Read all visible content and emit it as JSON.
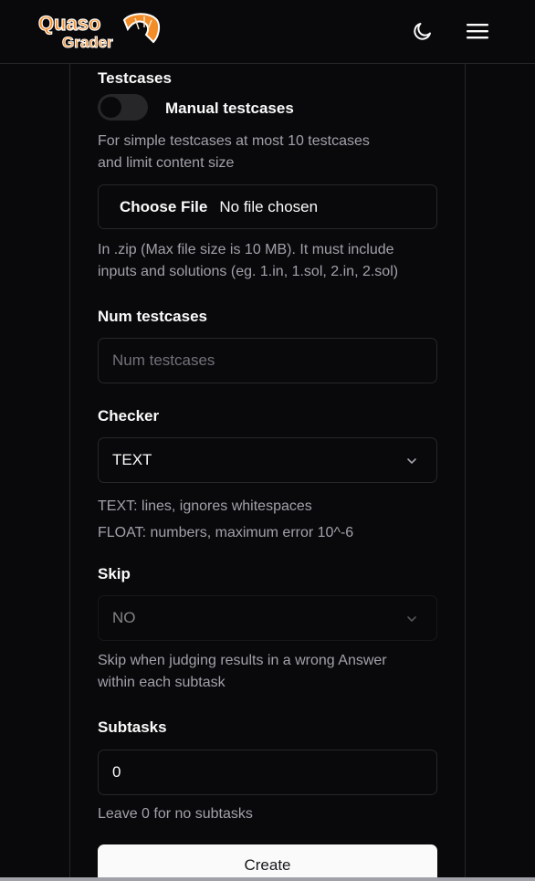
{
  "brand": {
    "line1": "Quaso",
    "line2": "Grader",
    "accent": "#f28c28"
  },
  "nav": {
    "theme_icon": "moon-icon",
    "menu_icon": "hamburger-menu-icon"
  },
  "testcases": {
    "label": "Testcases",
    "toggle_label": "Manual testcases",
    "toggle_on": false,
    "help": [
      "For simple testcases at most 10 testcases",
      "and limit content size"
    ],
    "file_button": "Choose File",
    "file_status": "No file chosen",
    "file_help": [
      "In .zip (Max file size is 10 MB). It must include",
      "inputs and solutions (eg. 1.in, 1.sol, 2.in, 2.sol)"
    ]
  },
  "num_testcases": {
    "label": "Num testcases",
    "placeholder": "Num testcases"
  },
  "checker": {
    "label": "Checker",
    "value": "TEXT",
    "help": [
      "TEXT: lines, ignores whitespaces",
      "FLOAT: numbers, maximum error 10^-6"
    ]
  },
  "skip": {
    "label": "Skip",
    "value": "NO",
    "help": [
      "Skip when judging results in a wrong Answer",
      "within each subtask"
    ]
  },
  "subtasks": {
    "label": "Subtasks",
    "value": "0",
    "help": "Leave 0 for no subtasks"
  },
  "create_button": "Create"
}
